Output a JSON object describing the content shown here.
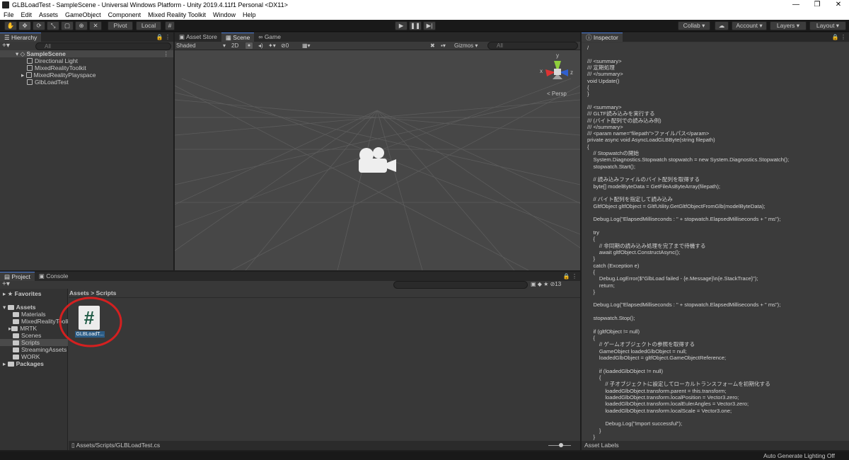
{
  "titlebar": {
    "title": "GLBLoadTest - SampleScene - Universal Windows Platform - Unity 2019.4.11f1 Personal <DX11>",
    "minimize": "—",
    "maximize": "❐",
    "close": "✕"
  },
  "menu": [
    "File",
    "Edit",
    "Assets",
    "GameObject",
    "Component",
    "Mixed Reality Toolkit",
    "Window",
    "Help"
  ],
  "toolbar": {
    "pivot": "Pivot",
    "local": "Local",
    "collab": "Collab ▾",
    "account": "Account",
    "layers": "Layers",
    "layout": "Layout"
  },
  "hierarchy": {
    "tab": "Hierarchy",
    "search_placeholder": "All",
    "scene": "SampleScene",
    "items": [
      "Directional Light",
      "MixedRealityToolkit",
      "MixedRealityPlayspace",
      "GlbLoadTest"
    ]
  },
  "scene_view": {
    "tabs": [
      "Asset Store",
      "Scene",
      "Game"
    ],
    "shading": "Shaded",
    "mode_2d": "2D",
    "gizmos": "Gizmos",
    "search_placeholder": "All",
    "hidden_count": "0",
    "persp": "< Persp",
    "axis_x": "x",
    "axis_y": "y",
    "axis_z": "z"
  },
  "inspector": {
    "tab": "Inspector",
    "code": [
      "/",
      "",
      "/// <summary>",
      "/// 定期処理",
      "/// </summary>",
      "void Update()",
      "{",
      "}",
      "",
      "/// <summary>",
      "/// GLTF読み込みを実行する",
      "/// (バイト配列での読み込み例)",
      "/// </summary>",
      "/// <param name=\"filepath\">ファイルパス</param>",
      "private async void AsyncLoadGLBByte(string filepath)",
      "{",
      "    // Stopwatchの開始",
      "    System.Diagnostics.Stopwatch stopwatch = new System.Diagnostics.Stopwatch();",
      "    stopwatch.Start();",
      "",
      "    // 読み込みファイルのバイト配列を取得する",
      "    byte[] modelByteData = GetFileAsByteArray(filepath);",
      "",
      "    // バイト配列を指定して読み込み",
      "    GltfObject gltfObject = GltfUtility.GetGltfObjectFromGlb(modelByteData);",
      "",
      "    Debug.Log(\"ElapsedMilliseconds : \" + stopwatch.ElapsedMilliseconds + \" ms\");",
      "",
      "    try",
      "    {",
      "        // 非同期の読み込み処理を完了まで待機する",
      "        await gltfObject.ConstructAsync();",
      "    }",
      "    catch (Exception e)",
      "    {",
      "        Debug.LogError($\"GlbLoad failed - {e.Message}\\n{e.StackTrace}\");",
      "        return;",
      "    }",
      "",
      "    Debug.Log(\"ElapsedMilliseconds : \" + stopwatch.ElapsedMilliseconds + \" ms\");",
      "",
      "    stopwatch.Stop();",
      "",
      "    if (gltfObject != null)",
      "    {",
      "        // ゲームオブジェクトの参照を取得する",
      "        GameObject loadedGlbObject = null;",
      "        loadedGlbObject = gltfObject.GameObjectReference;",
      "",
      "        if (loadedGlbObject != null)",
      "        {",
      "            // 子オブジェクトに設定してローカルトランスフォームを初期化する",
      "            loadedGlbObject.transform.parent = this.transform;",
      "            loadedGlbObject.transform.localPosition = Vector3.zero;",
      "            loadedGlbObject.transform.localEulerAngles = Vector3.zero;",
      "            loadedGlbObject.transform.localScale = Vector3.one;",
      "",
      "            Debug.Log(\"Import successful\");",
      "        }",
      "    }",
      "}"
    ],
    "asset_labels": "Asset Labels"
  },
  "project": {
    "tabs": [
      "Project",
      "Console"
    ],
    "favorites": "Favorites",
    "assets": "Assets",
    "folders": [
      "Materials",
      "MixedRealityToolkit",
      "MRTK",
      "Scenes",
      "Scripts",
      "StreamingAssets",
      "WORK"
    ],
    "packages": "Packages",
    "breadcrumb": "Assets > Scripts",
    "hidden_count": "13",
    "file_label": "GLBLoadT...",
    "file_icon_glyph": "#",
    "status_path": "Assets/Scripts/GLBLoadTest.cs"
  },
  "statusbar": {
    "text": "Auto Generate Lighting Off"
  },
  "colors": {
    "highlight_circle": "#d42020",
    "selection": "#2c5d87",
    "script_icon": "#1f5a45"
  }
}
